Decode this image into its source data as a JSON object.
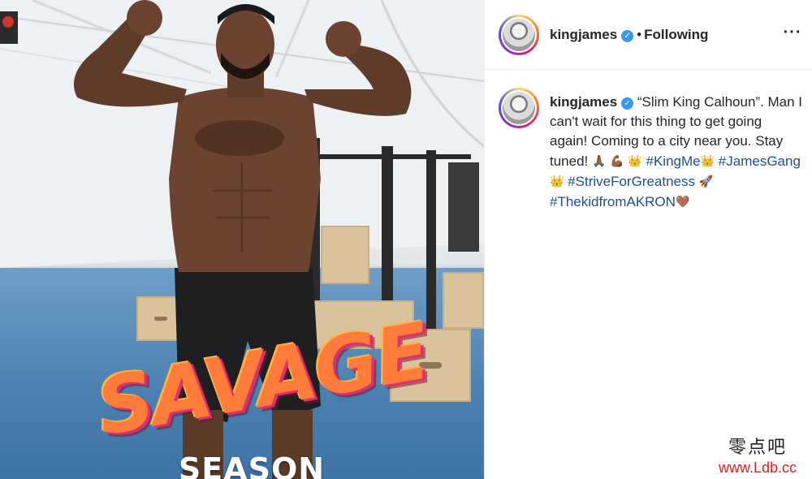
{
  "post": {
    "username": "kingjames",
    "verified_icon": "verified-badge-icon",
    "separator": "•",
    "follow_status": "Following",
    "more_icon": "more-options-icon",
    "more_glyph": "···"
  },
  "caption": {
    "username": "kingjames",
    "segments": [
      {
        "type": "text",
        "value": "“Slim King Calhoun”. Man I can't wait for this thing to get going again! Coming to a city near you. Stay tuned! "
      },
      {
        "type": "emoji",
        "value": "🙏🏾",
        "icon": "praying-hands-emoji"
      },
      {
        "type": "text",
        "value": " "
      },
      {
        "type": "emoji",
        "value": "💪🏾",
        "icon": "flexed-biceps-emoji"
      },
      {
        "type": "text",
        "value": " "
      },
      {
        "type": "emoji",
        "value": "👑",
        "icon": "crown-emoji"
      },
      {
        "type": "text",
        "value": " "
      },
      {
        "type": "hashtag",
        "value": "#KingMe"
      },
      {
        "type": "emoji",
        "value": "👑",
        "icon": "crown-emoji"
      },
      {
        "type": "text",
        "value": " "
      },
      {
        "type": "hashtag",
        "value": "#JamesGang"
      },
      {
        "type": "emoji",
        "value": "👑",
        "icon": "crown-emoji"
      },
      {
        "type": "text",
        "value": " "
      },
      {
        "type": "hashtag",
        "value": "#StriveForGreatness"
      },
      {
        "type": "text",
        "value": " "
      },
      {
        "type": "emoji",
        "value": "🚀",
        "icon": "rocket-emoji"
      },
      {
        "type": "text",
        "value": " "
      },
      {
        "type": "hashtag",
        "value": "#ThekidfromAKRON"
      },
      {
        "type": "emoji",
        "value": "🤎",
        "icon": "heart-emoji"
      }
    ]
  },
  "photo": {
    "sticker_main": "SAVAGE",
    "sticker_sub": "SEASON"
  },
  "watermark": {
    "cn": "零点吧",
    "url": "www.Ldb.cc"
  },
  "colors": {
    "link": "#1f4f8c",
    "verified": "#3897f0",
    "text": "#262626"
  }
}
